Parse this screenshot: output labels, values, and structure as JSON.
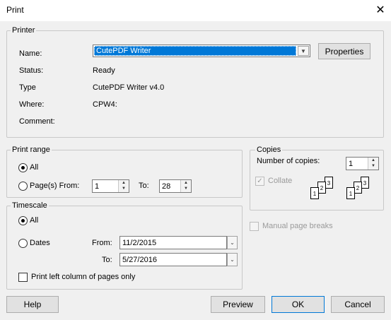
{
  "window": {
    "title": "Print"
  },
  "printer": {
    "legend": "Printer",
    "name_label": "Name:",
    "name_value": "CutePDF Writer",
    "properties_label": "Properties",
    "status_label": "Status:",
    "status_value": "Ready",
    "type_label": "Type",
    "type_value": "CutePDF Writer v4.0",
    "where_label": "Where:",
    "where_value": "CPW4:",
    "comment_label": "Comment:",
    "comment_value": ""
  },
  "print_range": {
    "legend": "Print range",
    "all_label": "All",
    "pages_label": "Page(s) From:",
    "from_value": "1",
    "to_label": "To:",
    "to_value": "28"
  },
  "copies": {
    "legend": "Copies",
    "number_label": "Number of copies:",
    "number_value": "1",
    "collate_label": "Collate",
    "page_numbers": [
      "1",
      "2",
      "3"
    ]
  },
  "manual_page_breaks": {
    "label": "Manual page breaks"
  },
  "timescale": {
    "legend": "Timescale",
    "all_label": "All",
    "dates_label": "Dates",
    "from_label": "From:",
    "from_value": "11/2/2015",
    "to_label": "To:",
    "to_value": "5/27/2016",
    "left_column_label": "Print left column of pages only"
  },
  "buttons": {
    "help": "Help",
    "preview": "Preview",
    "ok": "OK",
    "cancel": "Cancel"
  },
  "colors": {
    "selection": "#0078d7",
    "background": "#f0f0f0",
    "disabled_text": "#9a9a9a"
  }
}
